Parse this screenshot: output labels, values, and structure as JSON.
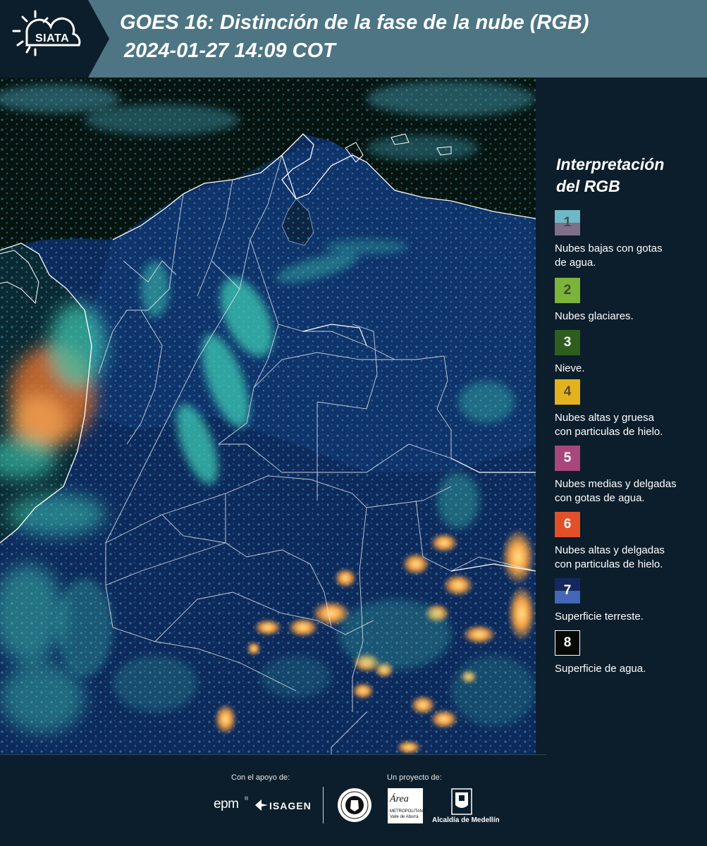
{
  "header": {
    "logo_text": "SIATA",
    "title_line1": "GOES 16: Distinción de la fase de la nube (RGB)",
    "title_line2": "2024-01-27 14:09 COT"
  },
  "legend": {
    "title_line1": "Interpretación",
    "title_line2": "del RGB",
    "items": [
      {
        "number": "1",
        "label_line1": "Nubes bajas con gotas",
        "label_line2": "de agua.",
        "color_top": "#6fb8c6",
        "color_bottom": "#7e6f8a",
        "number_color": "#4a4a5a"
      },
      {
        "number": "2",
        "label_line1": "Nubes glaciares.",
        "label_line2": "",
        "color_top": "#7bb33b",
        "color_bottom": "#7bb33b",
        "number_color": "#3a4a2a"
      },
      {
        "number": "3",
        "label_line1": "Nieve.",
        "label_line2": "",
        "color_top": "#2e5e1e",
        "color_bottom": "#2e5e1e",
        "number_color": "#ffffff"
      },
      {
        "number": "4",
        "label_line1": "Nubes altas y gruesa",
        "label_line2": "con particulas de hielo.",
        "color_top": "#e3b21f",
        "color_bottom": "#e3b21f",
        "number_color": "#5a4a2a"
      },
      {
        "number": "5",
        "label_line1": "Nubes medias y delgadas",
        "label_line2": "con gotas de agua.",
        "color_top": "#a9467c",
        "color_bottom": "#a9467c",
        "number_color": "#ffffff"
      },
      {
        "number": "6",
        "label_line1": "Nubes altas y delgadas",
        "label_line2": "con particulas de hielo.",
        "color_top": "#e2502a",
        "color_bottom": "#e2502a",
        "number_color": "#ffffff"
      },
      {
        "number": "7",
        "label_line1": "Superficie terreste.",
        "label_line2": "",
        "color_top": "#15285e",
        "color_bottom": "#4468b7",
        "number_color": "#ffffff"
      },
      {
        "number": "8",
        "label_line1": "Superficie de agua.",
        "label_line2": "",
        "color_top": "#050a05",
        "color_bottom": "#050a05",
        "number_color": "#ffffff"
      }
    ]
  },
  "footer": {
    "support_label": "Con el apoyo de:",
    "project_label": "Un proyecto de:",
    "epm": "epm",
    "isagen": "ISAGEN",
    "area_line1": "Área",
    "area_line2": "METROPOLITANA",
    "area_line3": "Valle de Aburrá",
    "alcaldia": "Alcaldía de Medellín"
  },
  "colors": {
    "header_bg": "#4d7584",
    "page_bg": "#0c1e2b",
    "land": "#0d2a6a",
    "ocean": "#06120c",
    "cloud_cyan": "#4fd6c0",
    "cloud_orange": "#f2a54a"
  }
}
